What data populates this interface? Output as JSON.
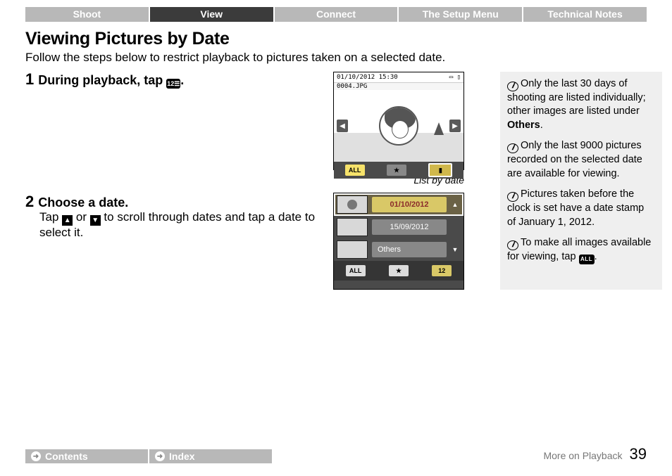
{
  "tabs": [
    "Shoot",
    "View",
    "Connect",
    "The Setup Menu",
    "Technical Notes"
  ],
  "active_tab": 1,
  "heading": "Viewing Pictures by Date",
  "intro": "Follow the steps below to restrict playback to pictures taken on a selected date.",
  "steps": {
    "s1": {
      "num": "1",
      "title_before": "During playback, tap ",
      "icon": "12",
      "title_after": "."
    },
    "s2": {
      "num": "2",
      "title": "Choose a date.",
      "body_before": "Tap ",
      "body_mid": " or ",
      "body_after": " to scroll through dates and tap a date to select it."
    }
  },
  "shot1": {
    "datetime": "01/10/2012  15:30",
    "filename": "0004.JPG",
    "btn_all": "ALL"
  },
  "caption1": "List by date",
  "shot2": {
    "date1": "01/10/2012",
    "date2": "15/09/2012",
    "others": "Others",
    "btn_all": "ALL",
    "btn_date": "12"
  },
  "notes": {
    "n1a": "Only the last 30 days of shooting are listed individually; other images are listed under ",
    "n1b": "Others",
    "n1c": ".",
    "n2": "Only the last 9000 pictures recorded on the selected date are available for viewing.",
    "n3": "Pictures taken before the clock is set have a date stamp of January 1, 2012.",
    "n4a": "To make all images available for viewing, tap ",
    "n4_pill": "ALL",
    "n4b": "."
  },
  "footer": {
    "contents": "Contents",
    "index": "Index",
    "section": "More on Playback",
    "page": "39"
  }
}
